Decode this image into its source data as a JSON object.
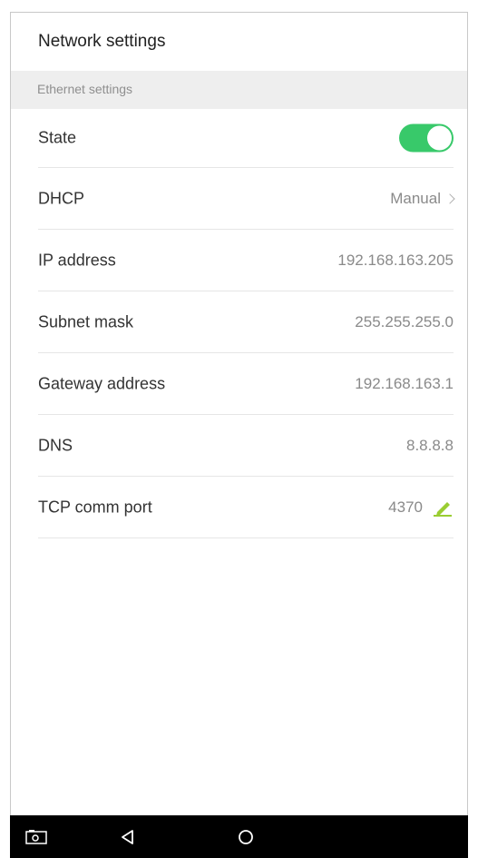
{
  "header": {
    "title": "Network settings"
  },
  "section": {
    "title": "Ethernet settings"
  },
  "rows": [
    {
      "label": "State",
      "toggle_on": true
    },
    {
      "label": "DHCP",
      "value": "Manual"
    },
    {
      "label": "IP address",
      "value": "192.168.163.205"
    },
    {
      "label": "Subnet mask",
      "value": "255.255.255.0"
    },
    {
      "label": "Gateway address",
      "value": "192.168.163.1"
    },
    {
      "label": "DNS",
      "value": "8.8.8.8"
    },
    {
      "label": "TCP comm port",
      "value": "4370"
    }
  ],
  "icons": {
    "dhcp": "chevron-right-icon",
    "tcp_port": "edit-pencil-icon",
    "nav_left": "screenshot-icon",
    "nav_back": "back-triangle-icon",
    "nav_home": "home-circle-icon"
  },
  "colors": {
    "toggle_on": "#38c96a",
    "edit_icon": "#9acd32",
    "section_bg": "#eeeeee",
    "nav_bar": "#000000"
  }
}
